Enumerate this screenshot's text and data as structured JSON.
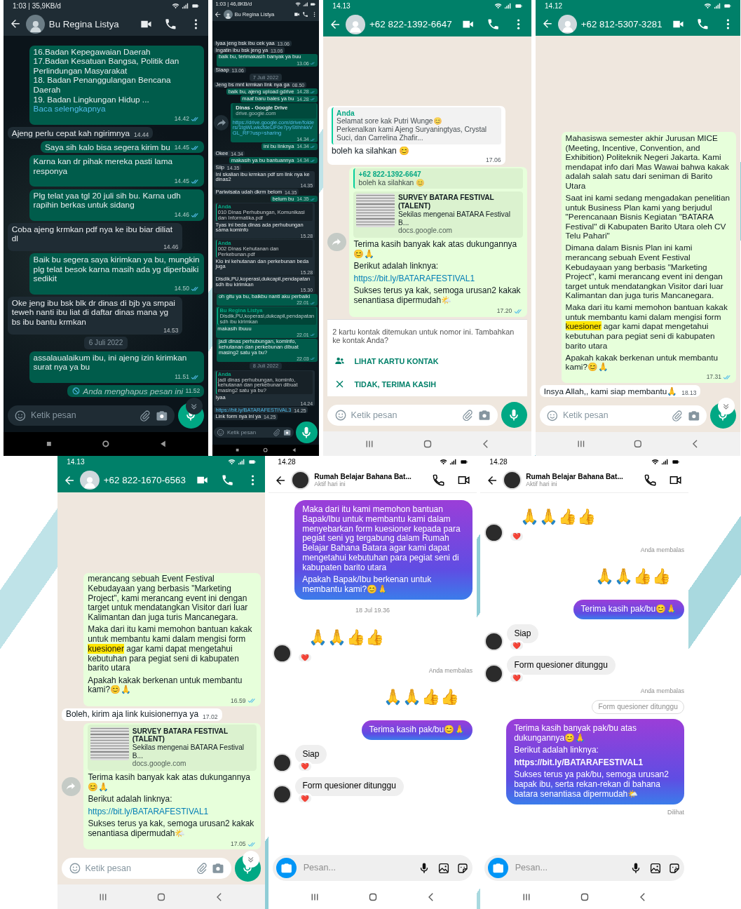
{
  "phones": [
    {
      "kind": "wa_dark",
      "status": {
        "time": "1:03 | 35,9KB/d"
      },
      "header": {
        "title": "Bu Regina Listya"
      },
      "scroll_down": true,
      "messages": [
        {
          "kind": "out",
          "paras": [
            "16.Badan Kepegawaian Daerah\n17.Badan Kesatuan Bangsa, Politik dan Perlindungan Masyarakat\n18. Badan Penanggulangan Bencana Daerah\n19. Badan Lingkungan Hidup ..."
          ],
          "more_link": "Baca selengkapnya",
          "time": "14.42"
        },
        {
          "kind": "in",
          "paras": [
            "Ajeng perlu cepat kah ngirimnya"
          ],
          "time": "14.44"
        },
        {
          "kind": "out",
          "paras": [
            "Saya sih kalo bisa segera kirim bu"
          ],
          "time": "14.45"
        },
        {
          "kind": "out",
          "paras": [
            "Karna kan dr pihak mereka pasti lama responya"
          ],
          "time": "14.45"
        },
        {
          "kind": "out",
          "paras": [
            "Plg telat yaa tgl 20 juli sih bu. Karna udh rapihin berkas untuk sidang"
          ],
          "time": "14.46"
        },
        {
          "kind": "in",
          "paras": [
            "Coba ajeng krmkan pdf nya ke ibu biar diliat dl"
          ],
          "time": "14.46"
        },
        {
          "kind": "out",
          "paras": [
            "Baik bu segera saya kirimkan ya bu, mungkin plg telat besok karna masih ada yg diperbaiki sedikit"
          ],
          "time": "14.50"
        },
        {
          "kind": "in",
          "paras": [
            "Oke jeng ibu bsk blk dr dinas di bjb ya smpai teweh nanti ibu liat di daftar dinas mana yg bs ibu bantu krmkan"
          ],
          "time": "14.53"
        },
        {
          "kind": "date",
          "text": "6 Juli 2022"
        },
        {
          "kind": "out",
          "paras": [
            "assalaualaikum ibu, ini ajeng izin kirimkan surat nya ya bu"
          ],
          "time": "11.51"
        },
        {
          "kind": "deleted",
          "text": "Anda menghapus pesan ini",
          "time": "11.52"
        }
      ],
      "composer": {
        "placeholder": "Ketik pesan"
      }
    },
    {
      "kind": "wa_dark",
      "status": {
        "time": "1:03 | 46,8KB/d"
      },
      "header": {
        "title": "Bu Regina Listya"
      },
      "scroll_down": false,
      "messages": [
        {
          "kind": "in",
          "paras": [
            "Iyaa jeng bsk ibu cek yaa"
          ],
          "time": "13.06"
        },
        {
          "kind": "in",
          "paras": [
            "Ingatin ibu bsk jeng ya"
          ],
          "time": "13.06"
        },
        {
          "kind": "out",
          "paras": [
            "baik bu, terimakasih banyak ya buu"
          ],
          "time": "13.06"
        },
        {
          "kind": "in",
          "paras": [
            "Siaap"
          ],
          "time": "13.06"
        },
        {
          "kind": "date",
          "text": "7 Juli 2022"
        },
        {
          "kind": "in",
          "paras": [
            "Jeng bs mnt krmkan link nya ga"
          ],
          "time": "08.50"
        },
        {
          "kind": "out",
          "paras": [
            "baik bu, ajeng upload gdrive"
          ],
          "time": "14.28"
        },
        {
          "kind": "out",
          "paras": [
            "maaf baru bales ya bu"
          ],
          "time": "14.28"
        },
        {
          "kind": "out",
          "forward_button": true,
          "preview": {
            "title": "Dinas - Google Drive",
            "domain": "drive.google.com"
          },
          "link": "https://drive.google.com/drive/folders/1tgWLwkcfdeLiF0e7pyStIhhkkVGL_RF?usp=sharing",
          "time": "14.34"
        },
        {
          "kind": "out",
          "paras": [
            "ini bu linknya"
          ],
          "time": "14.34"
        },
        {
          "kind": "in",
          "paras": [
            "Okee"
          ],
          "time": "14.34"
        },
        {
          "kind": "out",
          "paras": [
            "makasih ya bu bantuannya"
          ],
          "time": "14.34"
        },
        {
          "kind": "in",
          "paras": [
            "Siip"
          ],
          "time": "14.35"
        },
        {
          "kind": "in",
          "paras": [
            "Ini skalian ibu krmkan pdf sm link nya ke dinas2"
          ],
          "time": "14.35"
        },
        {
          "kind": "in",
          "paras": [
            "Pariwisata udah dkrm belom"
          ],
          "time": "14.35"
        },
        {
          "kind": "out",
          "paras": [
            "belum bu"
          ],
          "time": "14.35"
        },
        {
          "kind": "in",
          "quote": {
            "author": "Anda",
            "text": "010 Dinas Perhubungan, Komunikasi dan Informatika.pdf"
          },
          "paras": [
            "Tyas ini beda dinas ada perhubungan sama kominfo"
          ],
          "time": "15.28"
        },
        {
          "kind": "in",
          "quote": {
            "author": "Anda",
            "text": "002 Dinas Kehutanan dan Perkebunan.pdf"
          },
          "paras": [
            "Klo ini kehutanan dan perkebunan beda juga"
          ],
          "time": "15.28"
        },
        {
          "kind": "in",
          "paras": [
            "Disdik,PU,koperasi,dukcapil,pendapatan sdh ibu kirimkan"
          ],
          "time": "15.30"
        },
        {
          "kind": "out",
          "paras": [
            "oh gitu ya bu, baikbu nanti aku perbaiki"
          ],
          "time": "22.01"
        },
        {
          "kind": "out",
          "quote": {
            "author": "Bu Regina Listya",
            "text": "Disdik,PU,koperasi,dukcapil,pendapatan sdh ibu kirimkan"
          },
          "paras": [
            "makasih ibuuu"
          ],
          "time": "22.01"
        },
        {
          "kind": "out",
          "paras": [
            "jadi dinas perhubungan, kominfo, kehutanan dan perkebunan dibuat masing2 satu ya bu?"
          ],
          "time": "22.03"
        },
        {
          "kind": "date",
          "text": "8 Juli 2022"
        },
        {
          "kind": "in",
          "quote": {
            "author": "Anda",
            "text": "jadi dinas perhubungan, kominfo, kehutanan dan perkebunan dibuat masing2 satu ya bu?"
          },
          "paras": [
            "Iyaa"
          ],
          "time": "14.24"
        },
        {
          "kind": "in",
          "link": "https://bit.ly/BATARAFESTIVAL3",
          "time": "14.25"
        },
        {
          "kind": "in",
          "paras": [
            "Link form nya ini ya"
          ],
          "time": "14.25"
        }
      ],
      "composer": {
        "placeholder": "Ketik pesan"
      }
    },
    {
      "kind": "wa_light",
      "status": {
        "time": "14.13"
      },
      "header": {
        "title": "+62 822-1392-6647"
      },
      "scroll_down": false,
      "messages": [
        {
          "kind": "in",
          "quote": {
            "author": "Anda",
            "text": "Selamat sore kak Putri Wunge😊\nPerkenalkan kami Ajeng Suryaningtyas, Crystal Suci, dan Carrelina Zhafir..."
          },
          "paras": [
            "boleh ka silahkan 😊"
          ],
          "time": "17.06"
        },
        {
          "kind": "out",
          "forward_button": true,
          "quote": {
            "author": "+62 822-1392-6647",
            "text": "boleh ka silahkan 😊"
          },
          "preview": {
            "title": "SURVEY BATARA FESTIVAL (TALENT)",
            "description": "Sekilas mengenai BATARA Festival B...",
            "domain": "docs.google.com"
          },
          "paras": [
            "Terima kasih banyak kak atas dukungannya😊🙏",
            "Berikut adalah linknya:"
          ],
          "link": "https://bit.ly/BATARAFESTIVAL1",
          "after": [
            "Sukses terus ya kak, semoga urusan2 kakak senantiasa dipermudah🌤️"
          ],
          "time": "17.20"
        },
        {
          "kind": "notice",
          "text": "2 kartu kontak ditemukan untuk nomor ini. Tambahkan ke kontak Anda?",
          "actions": [
            "LIHAT KARTU KONTAK",
            "TIDAK, TERIMA KASIH"
          ]
        }
      ],
      "composer": {
        "placeholder": "Ketik pesan"
      }
    },
    {
      "kind": "wa_light",
      "status": {
        "time": "14.12"
      },
      "header": {
        "title": "+62 812-5307-3281"
      },
      "scroll_down": true,
      "messages": [
        {
          "kind": "out",
          "paras": [
            "Mahasiswa semester akhir Jurusan MICE (Meeting, Incentive, Convention, and Exhibition) Politeknik Negeri Jakarta. Kami mendapat info dari Mas Wawai bahwa kakak adalah salah satu dari seniman di Barito Utara",
            "Saat ini kami sedang mengadakan penelitian untuk Business Plan kami yang berjudul \"Perencanaan Bisnis Kegiatan \"BATARA Festival\" di Kabupaten Barito Utara oleh CV Telu Pahari\"",
            "Dimana dalam Bisnis Plan ini kami merancang sebuah Event Festival Kebudayaan yang berbasis \"Marketing Project\", kami merancang event ini dengan target untuk mendatangkan Visitor dari luar Kalimantan dan juga turis Mancanegara.",
            "Maka dari itu kami memohon bantuan kakak untuk membantu kami dalam mengisi form **kuesioner** agar kami dapat mengetahui kebutuhan para pegiat seni di kabupaten barito utara",
            "Apakah kakak berkenan untuk membantu kami?😊🙏"
          ],
          "time": "17.31"
        },
        {
          "kind": "in",
          "paras": [
            "Insya Allah,, kami siap membantu🙏"
          ],
          "time": "18.13"
        }
      ],
      "composer": {
        "placeholder": "Ketik pesan"
      }
    },
    {
      "kind": "wa_light",
      "status": {
        "time": "14.13"
      },
      "header": {
        "title": "+62 822-1670-6563"
      },
      "scroll_down": true,
      "messages": [
        {
          "kind": "out",
          "paras": [
            "merancang sebuah Event Festival Kebudayaan yang berbasis \"Marketing Project\", kami merancang event ini dengan target untuk mendatangkan Visitor dari luar Kalimantan dan juga turis Mancanegara.",
            "Maka dari itu kami memohon bantuan kakak untuk membantu kami dalam mengisi form **kuesioner** agar kami dapat mengetahui kebutuhan para pegiat seni di kabupaten barito utara",
            "Apakah kakak berkenan untuk membantu kami?😊🙏"
          ],
          "time": "16.59"
        },
        {
          "kind": "in",
          "paras": [
            "Boleh, kirim aja link kuisionernya ya"
          ],
          "time": "17.02"
        },
        {
          "kind": "out",
          "forward_button": true,
          "preview": {
            "title": "SURVEY BATARA FESTIVAL (TALENT)",
            "description": "Sekilas mengenai BATARA Festival B...",
            "domain": "docs.google.com"
          },
          "paras": [
            "Terima kasih banyak kak atas dukungannya😊🙏",
            "Berikut adalah linknya:"
          ],
          "link": "https://bit.ly/BATARAFESTIVAL1",
          "after": [
            "Sukses terus ya kak, semoga urusan2 kakak senantiasa dipermudah🌤️"
          ],
          "time": "17.05"
        }
      ],
      "composer": {
        "placeholder": "Ketik pesan"
      }
    },
    {
      "kind": "instagram",
      "status": {
        "time": "14.28"
      },
      "header": {
        "title": "Rumah Belajar Bahana Bat...",
        "subtitle": "Aktif hari ini"
      },
      "scroll_down": false,
      "messages": [
        {
          "kind": "out",
          "paras": [
            "Maka dari itu kami memohon bantuan Bapak/Ibu untuk membantu kami dalam menyebarkan form kuesioner kepada para pegiat seni yg tergabung dalam Rumah Belajar Bahana Batara agar kami dapat mengetahui kebutuhan para pegiat seni di kabupaten barito utara",
            "Apakah Bapak/Ibu berkenan untuk membantu kami?😊🙏"
          ]
        },
        {
          "kind": "date",
          "text": "18 Jul 19.36"
        },
        {
          "kind": "in",
          "emoji_only": true,
          "paras": [
            "🙏🙏👍👍"
          ],
          "reaction": "❤️"
        },
        {
          "kind": "label",
          "text": "Anda membalas"
        },
        {
          "kind": "out",
          "emoji_only": true,
          "paras": [
            "🙏🙏👍👍"
          ]
        },
        {
          "kind": "out",
          "paras": [
            "Terima kasih pak/bu😊🙏"
          ]
        },
        {
          "kind": "in",
          "paras": [
            "Siap"
          ],
          "reaction": "❤️"
        },
        {
          "kind": "in",
          "paras": [
            "Form quesioner ditunggu"
          ],
          "reaction": "❤️"
        }
      ],
      "composer": {
        "placeholder": "Pesan..."
      }
    },
    {
      "kind": "instagram",
      "status": {
        "time": "14.28"
      },
      "header": {
        "title": "Rumah Belajar Bahana Bat...",
        "subtitle": "Aktif hari ini"
      },
      "scroll_down": false,
      "messages": [
        {
          "kind": "in",
          "emoji_only": true,
          "paras": [
            "🙏🙏👍👍"
          ],
          "reaction": "❤️"
        },
        {
          "kind": "label",
          "text": "Anda membalas"
        },
        {
          "kind": "out",
          "emoji_only": true,
          "paras": [
            "🙏🙏👍👍"
          ]
        },
        {
          "kind": "out",
          "paras": [
            "Terima kasih pak/bu😊🙏"
          ]
        },
        {
          "kind": "in",
          "paras": [
            "Siap"
          ],
          "reaction": "❤️"
        },
        {
          "kind": "in",
          "paras": [
            "Form quesioner ditunggu"
          ],
          "reaction": "❤️"
        },
        {
          "kind": "label",
          "text": "Anda membalas"
        },
        {
          "kind": "reply_ref",
          "text": "Form quesioner ditunggu"
        },
        {
          "kind": "out",
          "paras": [
            "Terima kasih banyak pak/bu atas dukungannya😊🙏",
            "Berikut adalah linknya:"
          ],
          "link": "https://bit.ly/BATARAFESTIVAL1",
          "after": [
            "Sukses terus ya pak/bu, semoga urusan2 bapak ibu, serta rekan-rekan di bahana batara senantiasa dipermudah🌤️"
          ]
        },
        {
          "kind": "label",
          "text": "Dilihat"
        }
      ],
      "composer": {
        "placeholder": "Pesan..."
      }
    }
  ]
}
